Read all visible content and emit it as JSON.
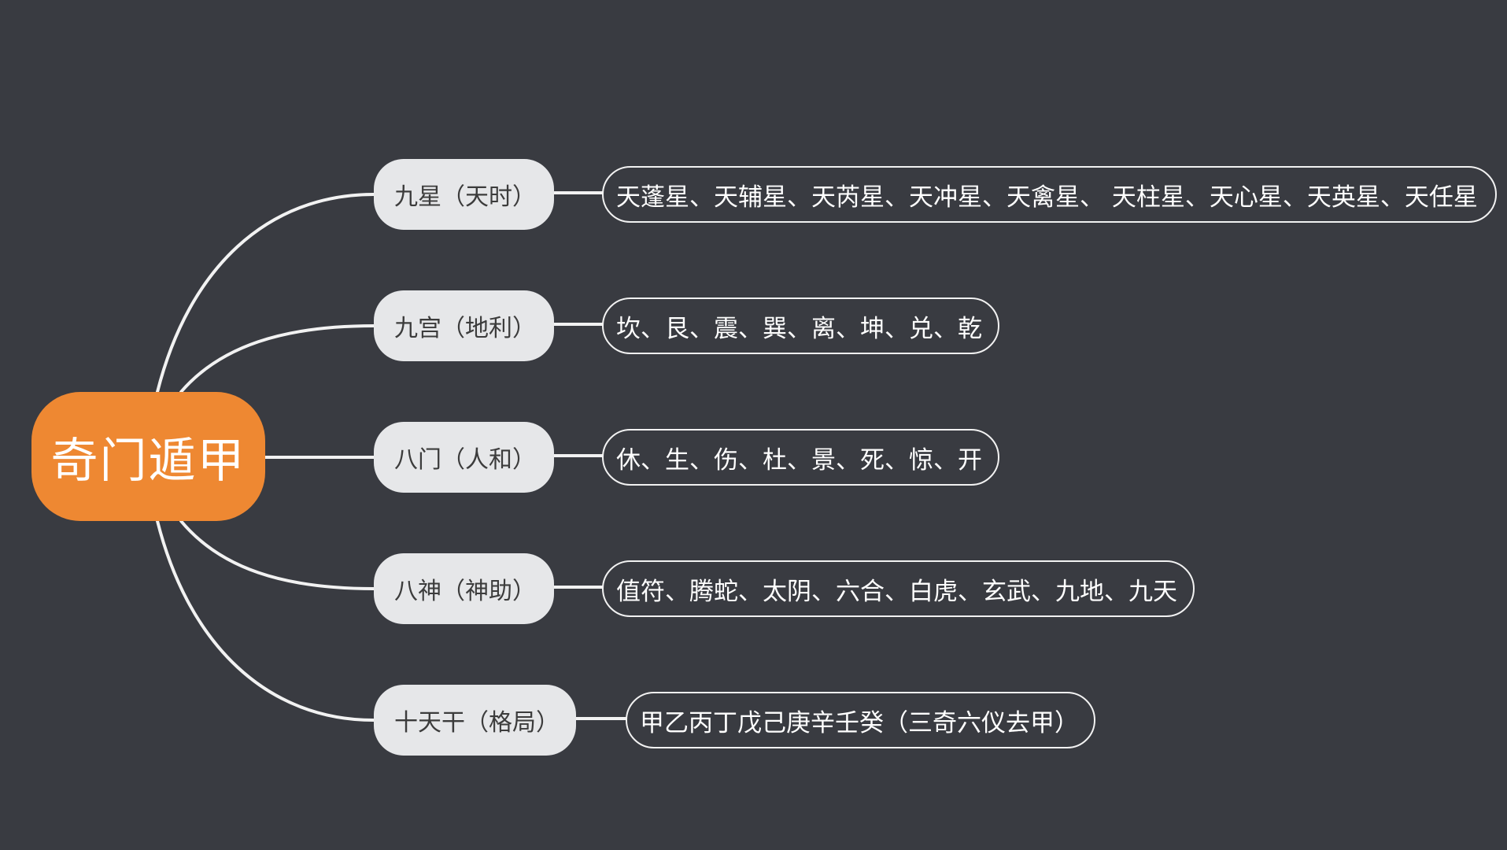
{
  "root": {
    "label": "奇门遁甲",
    "color": "#ee8832"
  },
  "branches": [
    {
      "label": "九星（天时）",
      "detail": "天蓬星、天辅星、天芮星、天冲星、天禽星、 天柱星、天心星、天英星、天任星"
    },
    {
      "label": "九宫（地利）",
      "detail": "坎、艮、震、巽、离、坤、兑、乾"
    },
    {
      "label": "八门（人和）",
      "detail": "休、生、伤、杜、景、死、惊、开"
    },
    {
      "label": "八神（神助）",
      "detail": "值符、腾蛇、太阴、六合、白虎、玄武、九地、九天"
    },
    {
      "label": "十天干（格局）",
      "detail": "甲乙丙丁戊己庚辛壬癸（三奇六仪去甲）"
    }
  ],
  "colors": {
    "background": "#393b41",
    "branch_fill": "#e6e7e9",
    "line": "#f2f2f2"
  }
}
